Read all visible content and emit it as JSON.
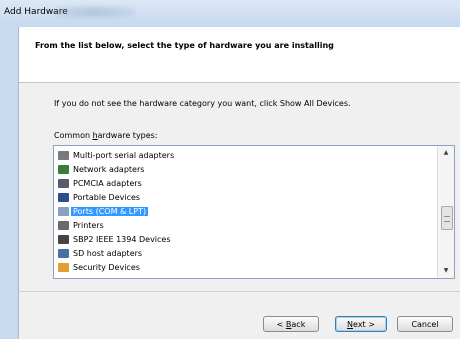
{
  "window": {
    "title": "Add Hardware"
  },
  "header": {
    "text": "From the list below, select the type of hardware you are installing"
  },
  "instruction": "If you do not see the hardware category you want, click Show All Devices.",
  "list": {
    "label_pre": "Common ",
    "label_accel": "h",
    "label_post": "ardware types:",
    "items": [
      {
        "label": "Multi-port serial adapters",
        "icon": "serial-adapter-icon",
        "color": "#7a7a7a"
      },
      {
        "label": "Network adapters",
        "icon": "network-adapter-icon",
        "color": "#3a7d3a"
      },
      {
        "label": "PCMCIA adapters",
        "icon": "pcmcia-icon",
        "color": "#5a5a6a"
      },
      {
        "label": "Portable Devices",
        "icon": "portable-device-icon",
        "color": "#2b4f86"
      },
      {
        "label": "Ports (COM & LPT)",
        "icon": "port-icon",
        "color": "#8aa0c0",
        "selected": true
      },
      {
        "label": "Printers",
        "icon": "printer-icon",
        "color": "#6a6a6a"
      },
      {
        "label": "SBP2 IEEE 1394 Devices",
        "icon": "ieee1394-icon",
        "color": "#444444"
      },
      {
        "label": "SD host adapters",
        "icon": "sd-adapter-icon",
        "color": "#4a6fa5"
      },
      {
        "label": "Security Devices",
        "icon": "security-device-icon",
        "color": "#e0a030"
      }
    ]
  },
  "buttons": {
    "back_pre": "< ",
    "back_accel": "B",
    "back_post": "ack",
    "next_accel": "N",
    "next_post": "ext >",
    "cancel": "Cancel"
  },
  "colors": {
    "selection": "#3399ff",
    "frame": "#c7daf0",
    "dialog_bg": "#f0f0f0"
  }
}
